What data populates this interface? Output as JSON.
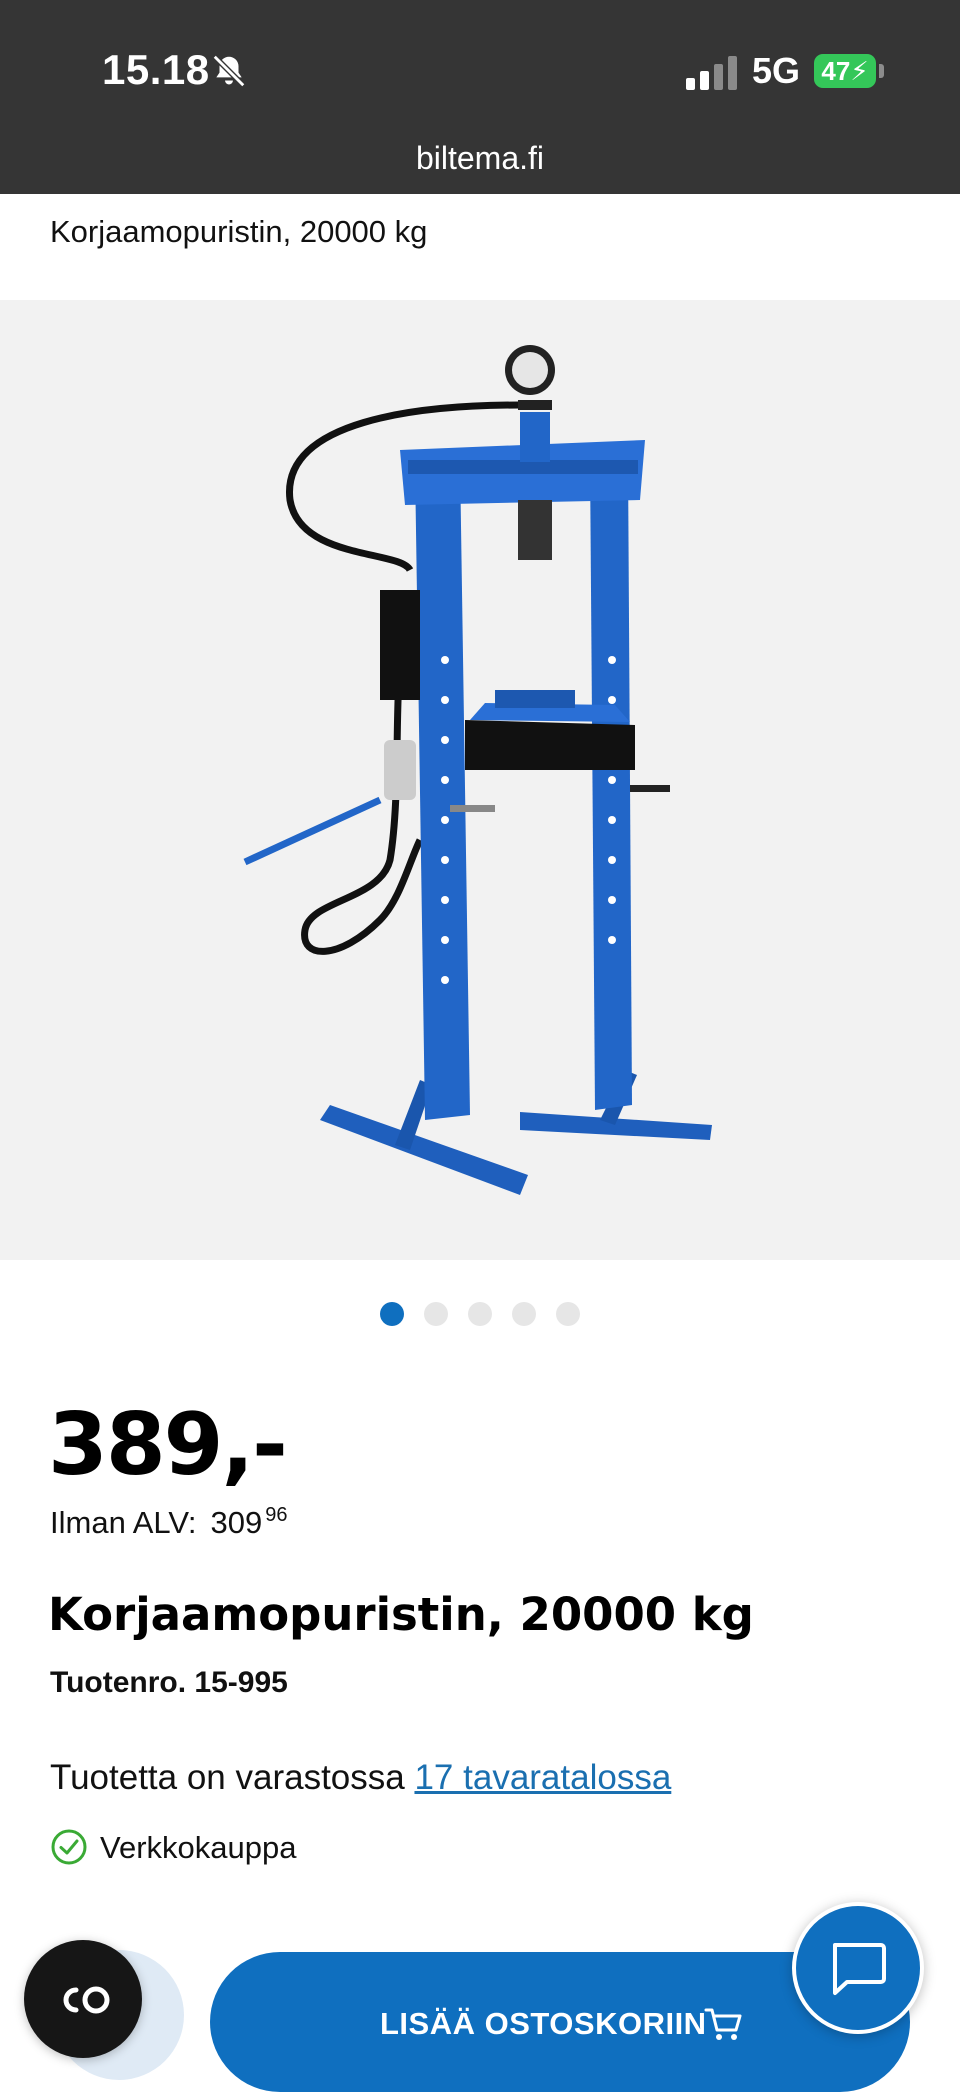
{
  "status_bar": {
    "time": "15.18",
    "network": "5G",
    "battery": "47"
  },
  "browser": {
    "url": "biltema.fi"
  },
  "header": {
    "title": "Korjaamopuristin, 20000 kg"
  },
  "gallery": {
    "image_count": 5,
    "active_index": 0
  },
  "product": {
    "price": "389,-",
    "vat_label": "Ilman ALV:",
    "vat_price_main": "309",
    "vat_price_cents": "96",
    "name": "Korjaamopuristin, 20000 kg",
    "sku": "Tuotenro. 15-995",
    "stock_text": "Tuotetta on varastossa",
    "stock_link": "17 tavaratalossa",
    "online_label": "Verkkokauppa"
  },
  "actions": {
    "add_to_cart": "LISÄÄ OSTOSKORIIN"
  },
  "colors": {
    "accent": "#0f6fbf",
    "status_bar": "#353535",
    "battery": "#34c759",
    "check": "#3aaa35"
  },
  "icons": {
    "cookie": "cookie-settings-icon",
    "chat": "chat-bubble-icon",
    "cart": "shopping-cart-icon"
  }
}
